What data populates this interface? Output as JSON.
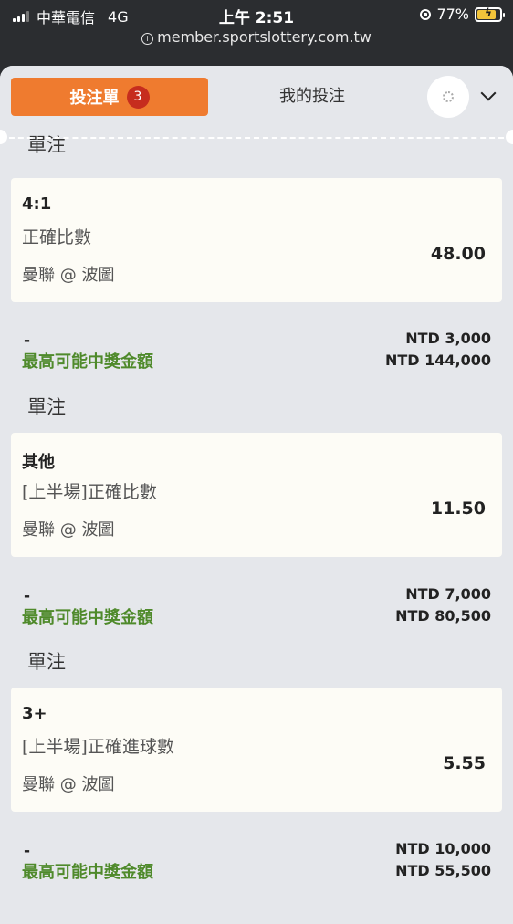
{
  "status_bar": {
    "carrier": "中華電信",
    "network": "4G",
    "time": "上午 2:51",
    "battery": "77%",
    "url": "member.sportslottery.com.tw"
  },
  "tabs": {
    "betslip_label": "投注單",
    "betslip_count": "3",
    "mybets_label": "我的投注"
  },
  "partial_section_title": "單注",
  "potential_label": "最高可能中獎金額",
  "bets": [
    {
      "section": "單注",
      "selection": "4:1",
      "market": "正確比數",
      "event": "曼聯 @ 波圖",
      "odds": "48.00",
      "stake_input": "-",
      "stake": "NTD 3,000",
      "payout": "NTD 144,000"
    },
    {
      "section": "單注",
      "selection": "其他",
      "market": "[上半場]正確比數",
      "event": "曼聯 @ 波圖",
      "odds": "11.50",
      "stake_input": "-",
      "stake": "NTD 7,000",
      "payout": "NTD 80,500"
    },
    {
      "section": "單注",
      "selection": "3+",
      "market": "[上半場]正確進球數",
      "event": "曼聯 @ 波圖",
      "odds": "5.55",
      "stake_input": "-",
      "stake": "NTD 10,000",
      "payout": "NTD 55,500"
    }
  ],
  "colors": {
    "accent": "#ef7b2f",
    "badge": "#c62d1e",
    "payout_label": "#4f8a2b",
    "card_bg": "#fdfcf6",
    "sheet_bg": "#e5e7eb"
  }
}
